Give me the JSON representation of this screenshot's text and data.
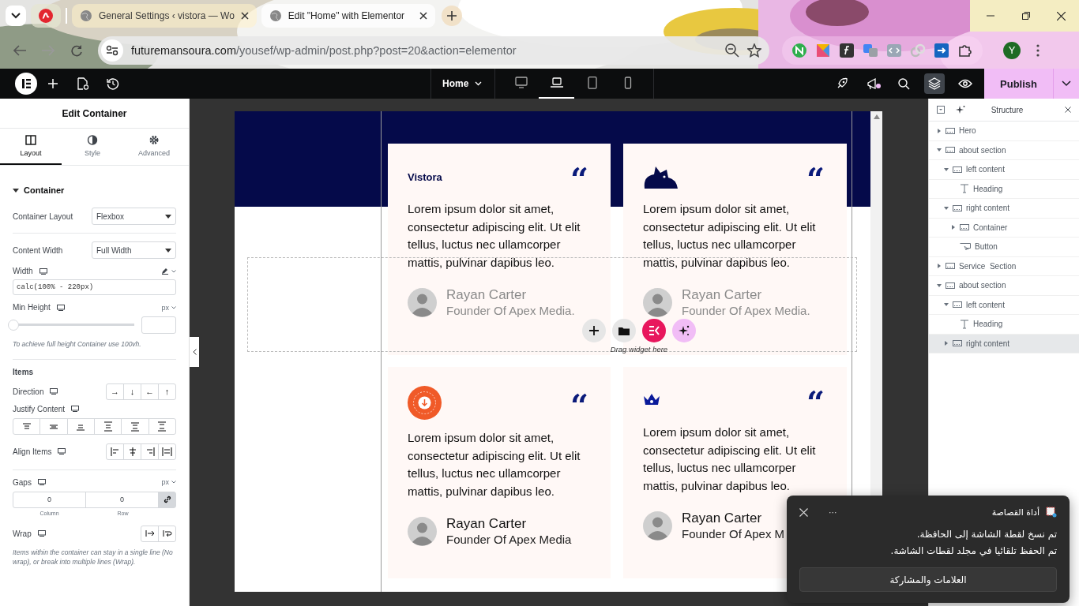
{
  "browser": {
    "tabs": [
      {
        "kind": "pinned",
        "selected": false
      },
      {
        "kind": "page",
        "title": "General Settings ‹ vistora — Wo",
        "selected": false
      },
      {
        "kind": "page",
        "title": "Edit \"Home\" with Elementor",
        "selected": true
      }
    ],
    "url_host": "futuremansoura.com",
    "url_path": "/yousef/wp-admin/post.php?post=20&action=elementor",
    "profile": "Y"
  },
  "editor_bar": {
    "page": "Home",
    "devices": [
      {
        "kind": "desktop",
        "selected": false
      },
      {
        "kind": "laptop",
        "selected": true
      },
      {
        "kind": "tablet",
        "selected": false
      },
      {
        "kind": "mobile",
        "selected": false
      }
    ],
    "publish": "Publish"
  },
  "panel": {
    "title": "Edit Container",
    "tabs": [
      {
        "kind": "layout",
        "label": "Layout",
        "selected": true
      },
      {
        "kind": "style",
        "label": "Style",
        "selected": false
      },
      {
        "kind": "advanced",
        "label": "Advanced",
        "selected": false
      }
    ],
    "section": "Container",
    "container_layout": {
      "label": "Container Layout",
      "value": "Flexbox"
    },
    "content_width": {
      "label": "Content Width",
      "value": "Full Width"
    },
    "width": {
      "label": "Width",
      "value": "calc(100% - 220px)"
    },
    "min_height": {
      "label": "Min Height",
      "unit": "px",
      "level": 0,
      "hint": "To achieve full height Container use 100vh."
    },
    "items_heading": "Items",
    "direction": {
      "label": "Direction",
      "options": [
        "→",
        "↓",
        "←",
        "↑"
      ]
    },
    "justify_content": {
      "label": "Justify Content"
    },
    "align_items": {
      "label": "Align Items"
    },
    "gaps": {
      "label": "Gaps",
      "unit": "px",
      "column": "0",
      "row": "0",
      "column_label": "Column",
      "row_label": "Row"
    },
    "wrap": {
      "label": "Wrap",
      "hint": "Items within the container can stay in a single line (No wrap), or break into multiple lines (Wrap)."
    }
  },
  "canvas": {
    "cards": [
      {
        "kind": "wordmark",
        "brand": "Vistora",
        "quote": "“",
        "text": "Lorem ipsum dolor sit amet, consectetur adipiscing elit. Ut elit tellus, luctus nec ullamcorper mattis, pulvinar dapibus leo.",
        "name": "Rayan Carter",
        "role": "Founder Of Apex Media.",
        "dimmed": true
      },
      {
        "kind": "cat",
        "quote": "“",
        "text": "Lorem ipsum dolor sit amet, consectetur adipiscing elit. Ut elit tellus, luctus nec ullamcorper mattis, pulvinar dapibus leo.",
        "name": "Rayan Carter",
        "role": "Founder Of Apex Media.",
        "dimmed": true
      },
      {
        "kind": "badge",
        "quote": "“",
        "text": "Lorem ipsum dolor sit amet, consectetur adipiscing elit. Ut elit tellus, luctus nec ullamcorper mattis, pulvinar dapibus leo.",
        "name": "Rayan Carter",
        "role": "Founder Of Apex Media",
        "dimmed": false
      },
      {
        "kind": "crown",
        "quote": "“",
        "text": "Lorem ipsum dolor sit amet, consectetur adipiscing elit. Ut elit tellus, luctus nec ullamcorper mattis, pulvinar dapibus leo.",
        "name": "Rayan Carter",
        "role": "Founder Of Apex M",
        "dimmed": false
      }
    ],
    "drop_hint": "Drag widget here"
  },
  "structure": {
    "title": "Structure",
    "items": [
      {
        "label": "Hero",
        "kind": "container",
        "expanded": false,
        "selected": false
      },
      {
        "label": "about section",
        "kind": "container",
        "expanded": true,
        "selected": false,
        "children": [
          {
            "label": "left content",
            "kind": "container",
            "expanded": true,
            "selected": false,
            "children": [
              {
                "label": "Heading",
                "kind": "heading",
                "selected": false
              }
            ]
          },
          {
            "label": "right content",
            "kind": "container",
            "expanded": true,
            "selected": false,
            "children": [
              {
                "label": "Container",
                "kind": "container",
                "expanded": false,
                "selected": false
              },
              {
                "label": "Button",
                "kind": "button",
                "selected": false
              }
            ]
          }
        ]
      },
      {
        "label": "Service  Section",
        "kind": "container",
        "expanded": false,
        "selected": false
      },
      {
        "label": "about section",
        "kind": "container",
        "expanded": true,
        "selected": false,
        "children": [
          {
            "label": "left content",
            "kind": "container",
            "expanded": true,
            "selected": false,
            "children": [
              {
                "label": "Heading",
                "kind": "heading",
                "selected": false
              }
            ]
          },
          {
            "label": "right content",
            "kind": "container",
            "expanded": false,
            "selected": true
          }
        ]
      }
    ]
  },
  "toast": {
    "app": "أداة القصاصة",
    "more": "···",
    "lines": [
      "تم نسخ لقطة الشاشة إلى الحافظة.",
      "تم الحفظ تلقائيا في مجلد لقطات الشاشة."
    ],
    "button": "العلامات والمشاركة"
  }
}
